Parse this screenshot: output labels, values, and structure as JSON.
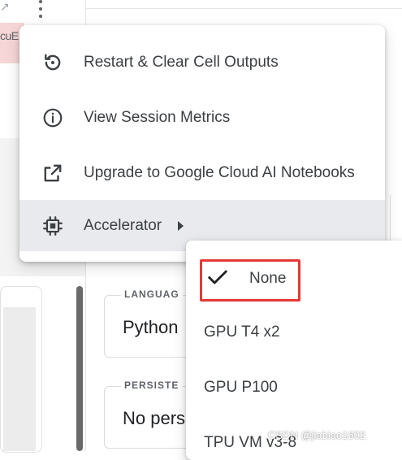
{
  "background": {
    "top_left_glyph": "↗",
    "cut_text": "cuΕ",
    "language_field": {
      "label": "LANGUAG",
      "value": "Python"
    },
    "persistence_field": {
      "label": "PERSISTE",
      "value": "No pers"
    }
  },
  "menu": {
    "items": [
      {
        "label": "Restart & Clear Cell Outputs",
        "icon": "restart-icon"
      },
      {
        "label": "View Session Metrics",
        "icon": "info-icon"
      },
      {
        "label": "Upgrade to Google Cloud AI Notebooks",
        "icon": "open-external-icon"
      },
      {
        "label": "Accelerator",
        "icon": "chip-icon",
        "has_submenu": true
      }
    ]
  },
  "submenu": {
    "items": [
      {
        "label": "None",
        "selected": true
      },
      {
        "label": "GPU T4 x2",
        "selected": false
      },
      {
        "label": "GPU P100",
        "selected": false
      },
      {
        "label": "TPU VM v3-8",
        "selected": false
      }
    ]
  },
  "watermark": "CSDN @jiabiao1602",
  "colors": {
    "highlight": "#e53935",
    "hover_bg": "#e8eaed",
    "text": "#3c4043"
  }
}
